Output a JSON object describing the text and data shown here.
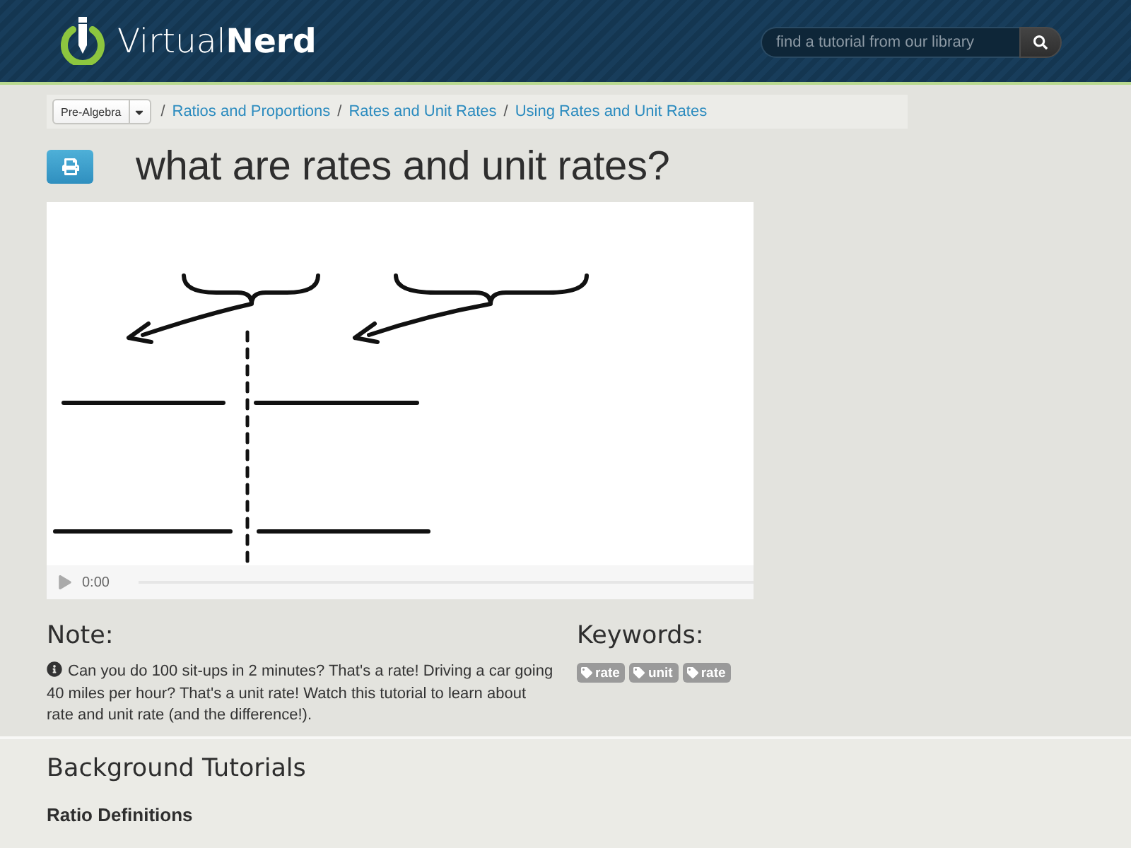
{
  "header": {
    "logo_text": "Virtual**Nerd**",
    "search": {
      "placeholder": "find a tutorial from our library"
    }
  },
  "breadcrumb": {
    "subject_select": "Pre-Algebra",
    "links": [
      {
        "separator": "/",
        "label": "Ratios and Proportions"
      },
      {
        "separator": "/",
        "label": "Rates and Unit Rates"
      },
      {
        "separator": "/",
        "label": "Using Rates and Unit Rates"
      }
    ]
  },
  "page_title": "what are rates and unit rates?",
  "video": {
    "time": "0:00"
  },
  "note": {
    "heading": "Note:",
    "text": "Can you do 100 sit-ups in 2 minutes? That's a rate! Driving a car going 40 miles per hour? That's a unit rate! Watch this tutorial to learn about rate and unit rate (and the difference!)."
  },
  "keywords": {
    "heading": "Keywords:",
    "tags": [
      "rate",
      "unit",
      "rate"
    ]
  },
  "background_tutorials": {
    "heading": "Background Tutorials",
    "items": [
      "Ratio Definitions"
    ]
  }
}
